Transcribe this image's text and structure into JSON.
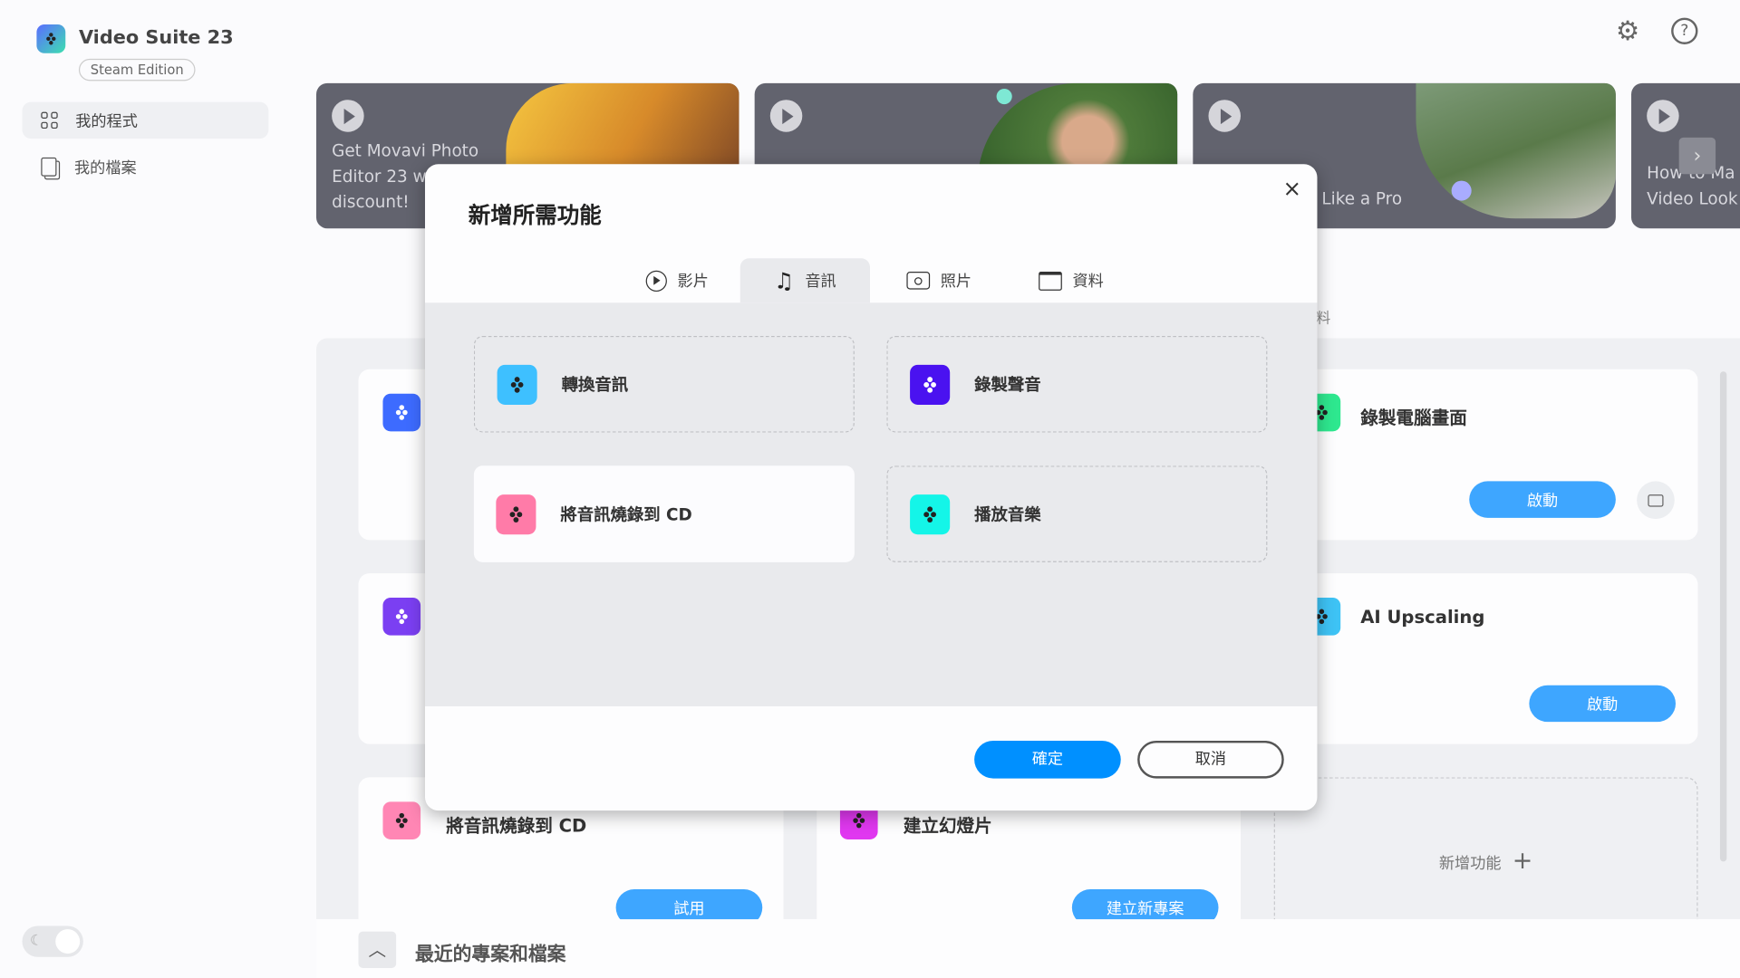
{
  "app": {
    "title": "Video Suite 23",
    "edition": "Steam Edition"
  },
  "sidebar": {
    "items": [
      {
        "label": "我的程式",
        "icon": "grid-icon",
        "active": true
      },
      {
        "label": "我的檔案",
        "icon": "files-icon",
        "active": false
      }
    ]
  },
  "header": {
    "settings_icon": "gear-icon",
    "help_icon": "help-icon"
  },
  "banners": [
    {
      "text": "Get Movavi Photo Editor 23 w... discount!",
      "lines": [
        "Get Movavi Photo",
        "Editor 23 w",
        "discount!"
      ]
    },
    {
      "text": ""
    },
    {
      "lines": [
        "Like a Pro"
      ]
    },
    {
      "lines": [
        "How to Ma",
        "Video Look"
      ]
    }
  ],
  "main": {
    "hidden_tab_fragment": "料",
    "cards": [
      {
        "title": "錄製電腦畫面",
        "button": "啟動",
        "color": "#2ee88f"
      },
      {
        "title": "AI Upscaling",
        "button": "啟動",
        "color": "#3ec3f5"
      },
      {
        "title": "將音訊燒錄到 CD",
        "button": "試用",
        "color": "#ff86b4"
      },
      {
        "title": "建立幻燈片",
        "button": "建立新專案",
        "color": "#e038f0"
      }
    ],
    "left_icons": [
      "#3d6bff",
      "#7b3ff2"
    ],
    "add_feature": "新增功能",
    "recent": "最近的專案和檔案"
  },
  "dialog": {
    "title": "新增所需功能",
    "close": "×",
    "tabs": [
      {
        "label": "影片",
        "icon": "play-circle-icon"
      },
      {
        "label": "音訊",
        "icon": "music-note-icon",
        "active": true
      },
      {
        "label": "照片",
        "icon": "camera-icon"
      },
      {
        "label": "資料",
        "icon": "folder-icon"
      }
    ],
    "items": [
      {
        "label": "轉換音訊",
        "color": "#3ec0ff",
        "selected": false
      },
      {
        "label": "錄製聲音",
        "color": "#4a12f0",
        "selected": false
      },
      {
        "label": "將音訊燒錄到 CD",
        "color": "#ff7ba8",
        "selected": true
      },
      {
        "label": "播放音樂",
        "color": "#14f5e8",
        "selected": false
      }
    ],
    "confirm": "確定",
    "cancel": "取消"
  },
  "colors": {
    "accent": "#0090ff",
    "banner": "#62636e"
  }
}
